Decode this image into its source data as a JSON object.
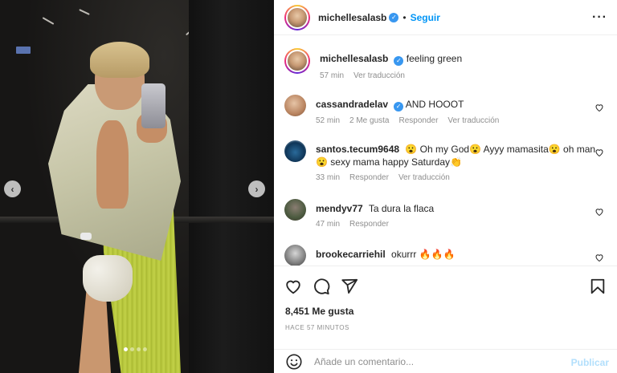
{
  "post": {
    "username": "michellesalasb",
    "follow_label": "Seguir",
    "more_icon": "ellipsis-icon",
    "caption": "feeling green",
    "caption_time": "57 min",
    "caption_translate": "Ver traducción"
  },
  "comments": [
    {
      "username": "cassandradelav",
      "verified": true,
      "text": "AND HOOOT",
      "time": "52 min",
      "likes": "2 Me gusta",
      "reply": "Responder",
      "translate": "Ver traducción"
    },
    {
      "username": "santos.tecum9648",
      "verified": false,
      "text": "😮 Oh my God😮 Ayyy mamasita😮 oh man 😮 sexy mama happy Saturday👏",
      "time": "33 min",
      "reply": "Responder",
      "translate": "Ver traducción"
    },
    {
      "username": "mendyv77",
      "verified": false,
      "text": "Ta dura la flaca",
      "time": "47 min",
      "reply": "Responder"
    },
    {
      "username": "brookecarriehil",
      "verified": false,
      "text": "okurrr 🔥🔥🔥"
    }
  ],
  "actions": {
    "like_icon": "heart-icon",
    "comment_icon": "comment-icon",
    "share_icon": "share-icon",
    "save_icon": "bookmark-icon"
  },
  "likes_label": "8,451 Me gusta",
  "timestamp": "HACE 57 MINUTOS",
  "add_comment": {
    "placeholder": "Añade un comentario...",
    "publish_label": "Publicar",
    "emoji_icon": "smiley-icon"
  },
  "carousel": {
    "slide_count": 4,
    "active_slide": 1,
    "prev_icon": "chevron-left-icon",
    "next_icon": "chevron-right-icon"
  },
  "colors": {
    "accent_blue": "#0095f6",
    "verified_blue": "#3897f0",
    "muted_text": "#8e8e8e",
    "publish_disabled": "#b2dffc"
  }
}
